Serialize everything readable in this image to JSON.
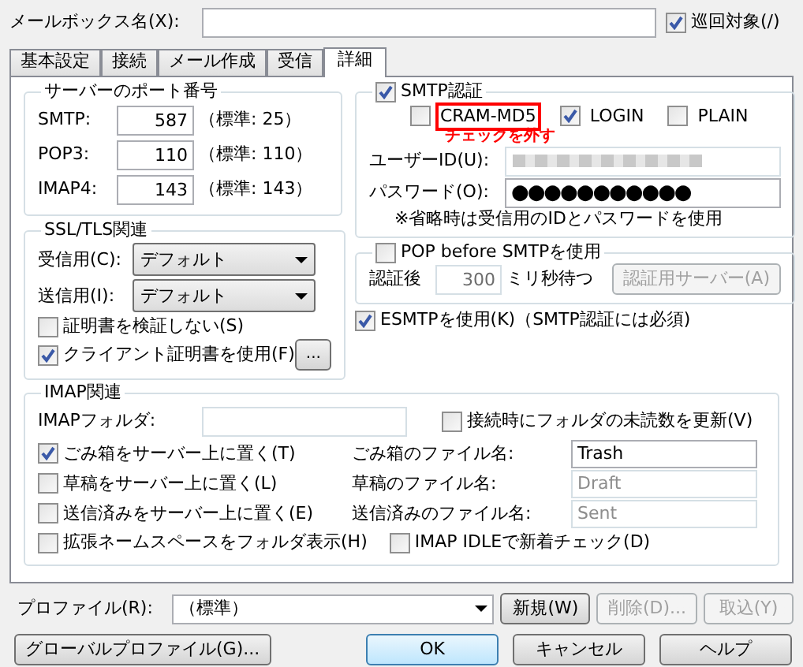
{
  "mailbox": {
    "label": "メールボックス名(X):",
    "round_target": {
      "label": "巡回対象(/)",
      "checked": true
    }
  },
  "tabs": [
    {
      "label": "基本設定",
      "selected": false
    },
    {
      "label": "接続",
      "selected": false
    },
    {
      "label": "メール作成",
      "selected": false
    },
    {
      "label": "受信",
      "selected": false
    },
    {
      "label": "詳細",
      "selected": true
    }
  ],
  "server_ports": {
    "title": "サーバーのポート番号",
    "rows": [
      {
        "label": "SMTP:",
        "value": "587",
        "default_text": "（標準: 25）"
      },
      {
        "label": "POP3:",
        "value": "110",
        "default_text": "（標準: 110）"
      },
      {
        "label": "IMAP4:",
        "value": "143",
        "default_text": "（標準: 143）"
      }
    ]
  },
  "ssl_tls": {
    "title": "SSL/TLS関連",
    "selects": [
      {
        "label": "受信用(C):",
        "value": "デフォルト"
      },
      {
        "label": "送信用(I):",
        "value": "デフォルト"
      }
    ],
    "checks": [
      {
        "label": "証明書を検証しない(S)",
        "checked": false
      },
      {
        "label": "クライアント証明書を使用(F)",
        "checked": true
      }
    ],
    "more_button": "..."
  },
  "smtp_auth": {
    "label": "SMTP認証",
    "checked": true,
    "methods": [
      {
        "label": "CRAM-MD5",
        "checked": false,
        "highlighted": true
      },
      {
        "label": "LOGIN",
        "checked": true,
        "highlighted": false
      },
      {
        "label": "PLAIN",
        "checked": false,
        "highlighted": false
      }
    ],
    "annotation": "チェックを外す",
    "user_id": {
      "label": "ユーザーID(U):"
    },
    "password": {
      "label": "パスワード(O):",
      "value": "●●●●●●●●●●●"
    },
    "note": "※省略時は受信用のIDとパスワードを使用"
  },
  "pop_before_smtp": {
    "label": "POP before SMTPを使用",
    "checked": false,
    "wait_label": "認証後",
    "wait_value": "300",
    "wait_unit": "ミリ秒待つ",
    "server_button": {
      "label": "認証用サーバー(A)",
      "disabled": true
    }
  },
  "esmtp": {
    "label": "ESMTPを使用(K)（SMTP認証には必須)",
    "checked": true
  },
  "imap": {
    "title": "IMAP関連",
    "folder_label": "IMAPフォルダ:",
    "update_unread": {
      "label": "接続時にフォルダの未読数を更新(V)",
      "checked": false
    },
    "rows": [
      {
        "label": "ごみ箱をサーバー上に置く(T)",
        "checked": true,
        "file_label": "ごみ箱のファイル名:",
        "file_value": "Trash",
        "disabled": false
      },
      {
        "label": "草稿をサーバー上に置く(L)",
        "checked": false,
        "file_label": "草稿のファイル名:",
        "file_value": "Draft",
        "disabled": true
      },
      {
        "label": "送信済みをサーバー上に置く(E)",
        "checked": false,
        "file_label": "送信済みのファイル名:",
        "file_value": "Sent",
        "disabled": true
      }
    ],
    "namespace": {
      "label": "拡張ネームスペースをフォルダ表示(H)",
      "checked": false
    },
    "idle": {
      "label": "IMAP IDLEで新着チェック(D)",
      "checked": false
    }
  },
  "profile": {
    "label": "プロファイル(R):",
    "value": "（標準）",
    "buttons": [
      {
        "label": "新規(W)",
        "disabled": false
      },
      {
        "label": "削除(D)...",
        "disabled": true
      },
      {
        "label": "取込(Y)",
        "disabled": true
      }
    ]
  },
  "footer_buttons": [
    {
      "label": "グローバルプロファイル(G)...",
      "kind": "left",
      "default": false
    },
    {
      "label": "OK",
      "kind": "right",
      "default": true
    },
    {
      "label": "キャンセル",
      "kind": "right",
      "default": false
    },
    {
      "label": "ヘルプ",
      "kind": "right",
      "default": false
    }
  ]
}
